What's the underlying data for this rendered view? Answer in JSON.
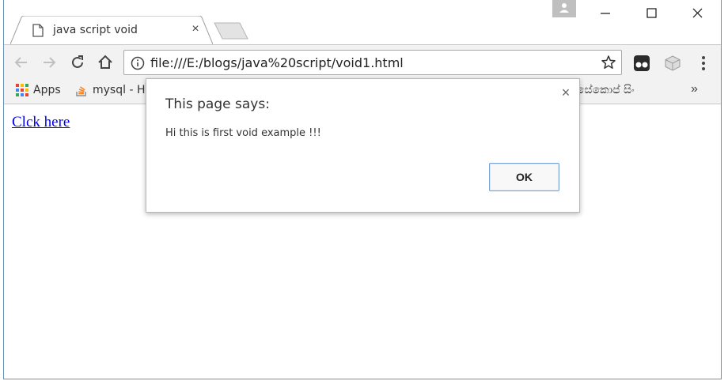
{
  "tab": {
    "title": "java script void",
    "close_glyph": "×",
    "page_icon": "page-icon"
  },
  "window_controls": {
    "minimize_icon": "minimize-icon",
    "maximize_icon": "maximize-icon",
    "close_icon": "close-icon",
    "profile_icon": "person-icon"
  },
  "toolbar": {
    "back_icon": "arrow-left-icon",
    "forward_icon": "arrow-right-icon",
    "reload_icon": "reload-icon",
    "home_icon": "home-icon",
    "url": "file:///E:/blogs/java%20script/void1.html",
    "info_icon": "info-icon",
    "star_icon": "star-icon",
    "menu_icon": "vertical-dots-icon"
  },
  "bookmarks": {
    "apps_label": "Apps",
    "mysql_label": "mysql - H",
    "sinhala_label": "සේකොප් සිං",
    "more_glyph": "»"
  },
  "page": {
    "link_text": "Clck here"
  },
  "dialog": {
    "title": "This page says:",
    "message": "Hi this is first void example !!!",
    "ok_label": "OK",
    "close_glyph": "×"
  },
  "colors": {
    "link": "#0000ee",
    "ok_border": "#7aa2d6",
    "toolbar_bg": "#f2f2f2"
  }
}
